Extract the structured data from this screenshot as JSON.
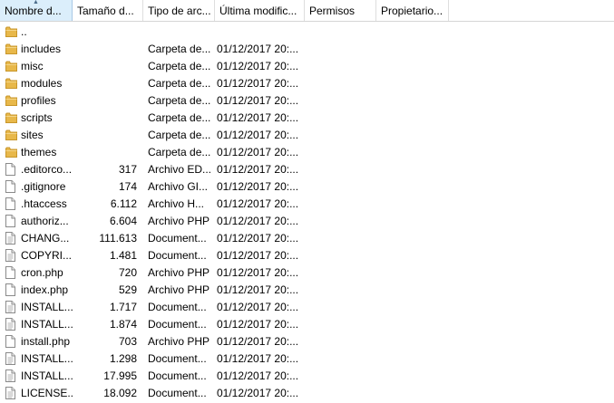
{
  "columns": [
    "Nombre d...",
    "Tamaño d...",
    "Tipo de arc...",
    "Última modific...",
    "Permisos",
    "Propietario..."
  ],
  "colors": {
    "sorted_header": "#dbeefb",
    "folder": "#e8b84a"
  },
  "rows": [
    {
      "icon": "folder-icon",
      "name": "..",
      "size": "",
      "type": "",
      "modified": ""
    },
    {
      "icon": "folder-icon",
      "name": "includes",
      "size": "",
      "type": "Carpeta de...",
      "modified": "01/12/2017 20:..."
    },
    {
      "icon": "folder-icon",
      "name": "misc",
      "size": "",
      "type": "Carpeta de...",
      "modified": "01/12/2017 20:..."
    },
    {
      "icon": "folder-icon",
      "name": "modules",
      "size": "",
      "type": "Carpeta de...",
      "modified": "01/12/2017 20:..."
    },
    {
      "icon": "folder-icon",
      "name": "profiles",
      "size": "",
      "type": "Carpeta de...",
      "modified": "01/12/2017 20:..."
    },
    {
      "icon": "folder-icon",
      "name": "scripts",
      "size": "",
      "type": "Carpeta de...",
      "modified": "01/12/2017 20:..."
    },
    {
      "icon": "folder-icon",
      "name": "sites",
      "size": "",
      "type": "Carpeta de...",
      "modified": "01/12/2017 20:..."
    },
    {
      "icon": "folder-icon",
      "name": "themes",
      "size": "",
      "type": "Carpeta de...",
      "modified": "01/12/2017 20:..."
    },
    {
      "icon": "file-icon",
      "name": ".editorco...",
      "size": "317",
      "type": "Archivo ED...",
      "modified": "01/12/2017 20:..."
    },
    {
      "icon": "file-icon",
      "name": ".gitignore",
      "size": "174",
      "type": "Archivo GI...",
      "modified": "01/12/2017 20:..."
    },
    {
      "icon": "file-icon",
      "name": ".htaccess",
      "size": "6.112",
      "type": "Archivo H...",
      "modified": "01/12/2017 20:..."
    },
    {
      "icon": "file-icon",
      "name": "authoriz...",
      "size": "6.604",
      "type": "Archivo PHP",
      "modified": "01/12/2017 20:..."
    },
    {
      "icon": "text-file-icon",
      "name": "CHANG...",
      "size": "111.613",
      "type": "Document...",
      "modified": "01/12/2017 20:..."
    },
    {
      "icon": "text-file-icon",
      "name": "COPYRI...",
      "size": "1.481",
      "type": "Document...",
      "modified": "01/12/2017 20:..."
    },
    {
      "icon": "file-icon",
      "name": "cron.php",
      "size": "720",
      "type": "Archivo PHP",
      "modified": "01/12/2017 20:..."
    },
    {
      "icon": "file-icon",
      "name": "index.php",
      "size": "529",
      "type": "Archivo PHP",
      "modified": "01/12/2017 20:..."
    },
    {
      "icon": "text-file-icon",
      "name": "INSTALL...",
      "size": "1.717",
      "type": "Document...",
      "modified": "01/12/2017 20:..."
    },
    {
      "icon": "text-file-icon",
      "name": "INSTALL...",
      "size": "1.874",
      "type": "Document...",
      "modified": "01/12/2017 20:..."
    },
    {
      "icon": "file-icon",
      "name": "install.php",
      "size": "703",
      "type": "Archivo PHP",
      "modified": "01/12/2017 20:..."
    },
    {
      "icon": "text-file-icon",
      "name": "INSTALL...",
      "size": "1.298",
      "type": "Document...",
      "modified": "01/12/2017 20:..."
    },
    {
      "icon": "text-file-icon",
      "name": "INSTALL...",
      "size": "17.995",
      "type": "Document...",
      "modified": "01/12/2017 20:..."
    },
    {
      "icon": "text-file-icon",
      "name": "LICENSE....",
      "size": "18.092",
      "type": "Document...",
      "modified": "01/12/2017 20:..."
    }
  ]
}
